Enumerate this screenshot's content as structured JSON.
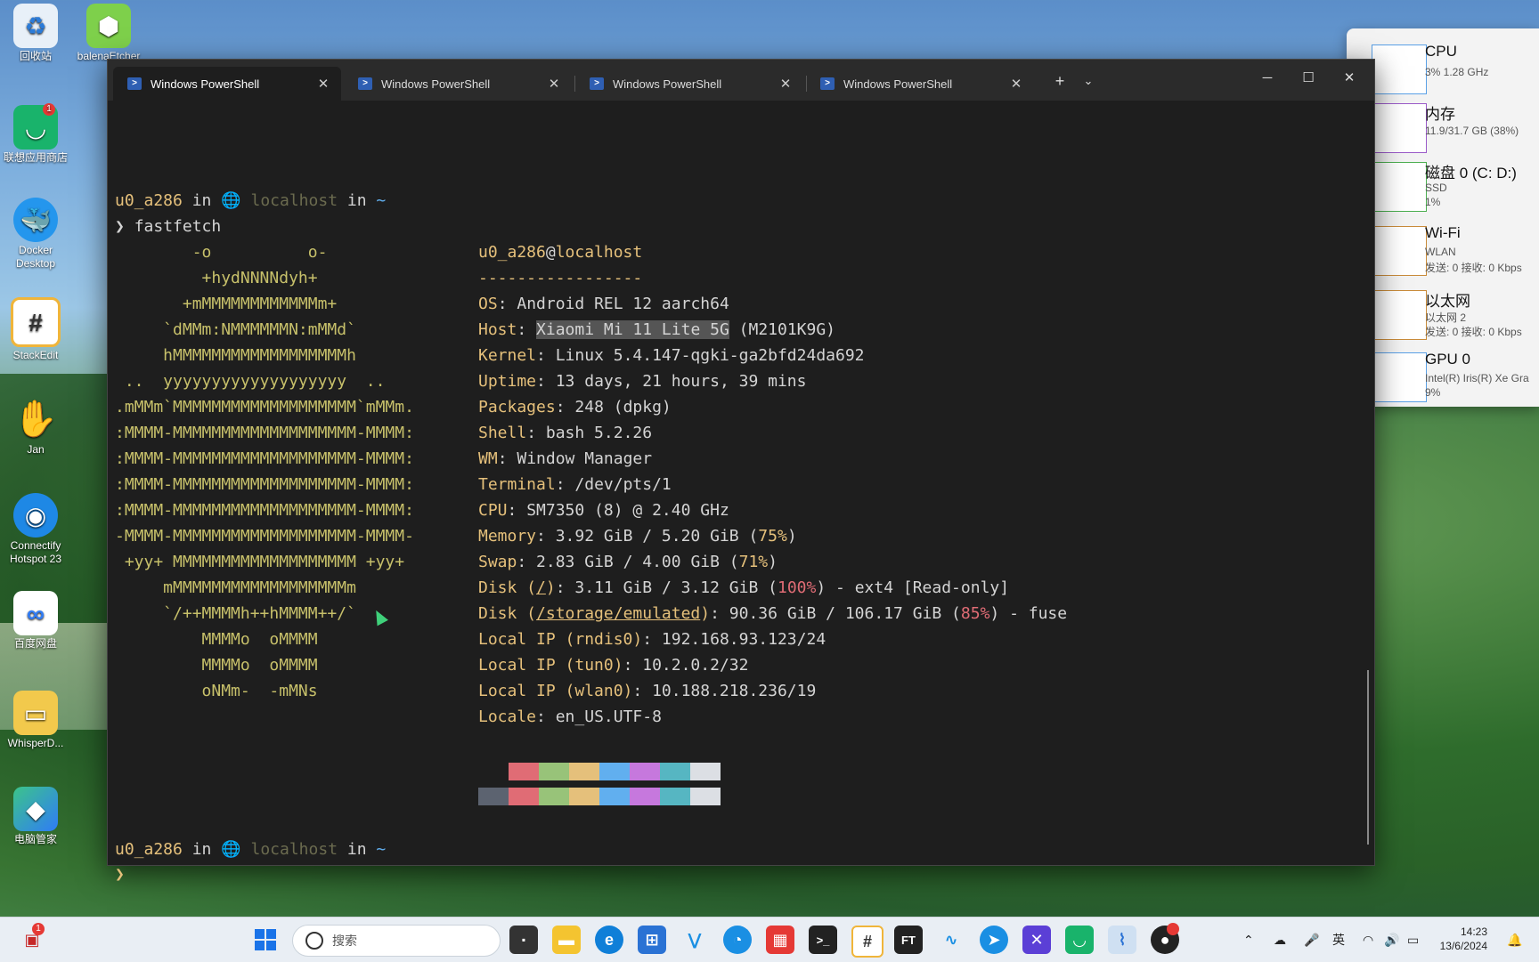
{
  "desktop": {
    "icons": [
      {
        "label": "回收站"
      },
      {
        "label": "balenaEtcher"
      },
      {
        "label": "联想应用商店"
      },
      {
        "label": "Docker Desktop"
      },
      {
        "label": "StackEdit"
      },
      {
        "label": "Jan"
      },
      {
        "label": "Connectify Hotspot 23"
      },
      {
        "label": "百度网盘"
      },
      {
        "label": "WhisperD..."
      },
      {
        "label": "电脑管家"
      }
    ]
  },
  "taskmanager": {
    "items": [
      {
        "title": "CPU",
        "sub1": "3% 1.28 GHz",
        "sub2": ""
      },
      {
        "title": "内存",
        "sub1": "11.9/31.7 GB (38%)",
        "sub2": ""
      },
      {
        "title": "磁盘 0 (C: D:)",
        "sub1": "SSD",
        "sub2": "1%"
      },
      {
        "title": "Wi-Fi",
        "sub1": "WLAN",
        "sub2": "发送: 0 接收: 0 Kbps"
      },
      {
        "title": "以太网",
        "sub1": "以太网 2",
        "sub2": "发送: 0 接收: 0 Kbps"
      },
      {
        "title": "GPU 0",
        "sub1": "Intel(R) Iris(R) Xe Gra",
        "sub2": "9%"
      }
    ]
  },
  "terminal": {
    "tabs": [
      {
        "label": "Windows PowerShell"
      },
      {
        "label": "Windows PowerShell"
      },
      {
        "label": "Windows PowerShell"
      },
      {
        "label": "Windows PowerShell"
      }
    ],
    "prompt": {
      "user": "u0_a286",
      "in": "in",
      "host": "localhost",
      "dir": "~",
      "arrow": "❯"
    },
    "command": "fastfetch",
    "art": [
      "        -o          o-",
      "         +hydNNNNdyh+",
      "       +mMMMMMMMMMMMMm+",
      "     `dMMm:NMMMMMMN:mMMd`",
      "     hMMMMMMMMMMMMMMMMMMh",
      " ..  yyyyyyyyyyyyyyyyyyy  ..",
      ".mMMm`MMMMMMMMMMMMMMMMMMM`mMMm.",
      ":MMMM-MMMMMMMMMMMMMMMMMMM-MMMM:",
      ":MMMM-MMMMMMMMMMMMMMMMMMM-MMMM:",
      ":MMMM-MMMMMMMMMMMMMMMMMMM-MMMM:",
      ":MMMM-MMMMMMMMMMMMMMMMMMM-MMMM:",
      "-MMMM-MMMMMMMMMMMMMMMMMMM-MMMM-",
      " +yy+ MMMMMMMMMMMMMMMMMMM +yy+",
      "     mMMMMMMMMMMMMMMMMMMm",
      "     `/++MMMMh++hMMMM++/`",
      "         MMMMo  oMMMM",
      "         MMMMo  oMMMM",
      "         oNMm-  -mMNs"
    ],
    "userhost": {
      "user": "u0_a286",
      "at": "@",
      "host": "localhost"
    },
    "separator": "-----------------",
    "info": {
      "os": {
        "key": "OS",
        "value": "Android REL 12 aarch64"
      },
      "host": {
        "key": "Host",
        "value": "Xiaomi Mi 11 Lite 5G",
        "extra": "(M2101K9G)"
      },
      "kernel": {
        "key": "Kernel",
        "value": "Linux 5.4.147-qgki-ga2bfd24da692"
      },
      "uptime": {
        "key": "Uptime",
        "value": "13 days, 21 hours, 39 mins"
      },
      "packages": {
        "key": "Packages",
        "value": "248 (dpkg)"
      },
      "shell": {
        "key": "Shell",
        "value": "bash 5.2.26"
      },
      "wm": {
        "key": "WM",
        "value": "Window Manager"
      },
      "terminal": {
        "key": "Terminal",
        "value": "/dev/pts/1"
      },
      "cpu": {
        "key": "CPU",
        "value": "SM7350 (8) @ 2.40 GHz"
      },
      "memory": {
        "key": "Memory",
        "value": "3.92 GiB / 5.20 GiB (",
        "pct": "75%",
        "tail": ")"
      },
      "swap": {
        "key": "Swap",
        "value": "2.83 GiB / 4.00 GiB (",
        "pct": "71%",
        "tail": ")"
      },
      "disk1": {
        "key": "Disk (",
        "path": "/",
        "keytail": ")",
        "value": "3.11 GiB / 3.12 GiB (",
        "pct": "100%",
        "tail": ") - ext4 [Read-only]"
      },
      "disk2": {
        "key": "Disk (",
        "path": "/storage/emulated",
        "keytail": ")",
        "value": "90.36 GiB / 106.17 GiB (",
        "pct": "85%",
        "tail": ") - fuse"
      },
      "ip1": {
        "key": "Local IP (rndis0)",
        "value": "192.168.93.123/24"
      },
      "ip2": {
        "key": "Local IP (tun0)",
        "value": "10.2.0.2/32"
      },
      "ip3": {
        "key": "Local IP (wlan0)",
        "value": "10.188.218.236/19"
      },
      "locale": {
        "key": "Locale",
        "value": "en_US.UTF-8"
      }
    },
    "palette": {
      "row1": [
        "#1e1e1e",
        "#e06c75",
        "#98c379",
        "#e5c07b",
        "#61afef",
        "#c678dd",
        "#56b6c2",
        "#dcdfe4"
      ],
      "row2": [
        "#5c6370",
        "#e06c75",
        "#98c379",
        "#e5c07b",
        "#61afef",
        "#c678dd",
        "#56b6c2",
        "#dcdfe4"
      ]
    }
  },
  "taskbar": {
    "search_placeholder": "搜索",
    "ime": "英",
    "time": "14:23",
    "date": "13/6/2024",
    "desktop_badge": "1",
    "store_badge": "1"
  }
}
